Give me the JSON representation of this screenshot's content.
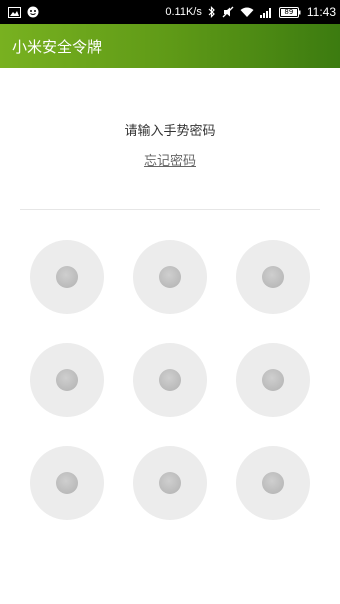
{
  "status_bar": {
    "network_speed": "0.11K/s",
    "battery_level": "89",
    "time": "11:43",
    "icons": [
      "image-icon",
      "notification-face-icon",
      "bluetooth-icon",
      "silent-icon",
      "wifi-icon",
      "signal-icon",
      "battery-icon"
    ]
  },
  "app_bar": {
    "title": "小米安全令牌",
    "gradient_colors": [
      "#78b120",
      "#3c7b10"
    ]
  },
  "lock": {
    "prompt": "请输入手势密码",
    "forgot_link": "忘记密码"
  },
  "pattern_grid": {
    "rows": 3,
    "cols": 3,
    "node_color": "#ececec",
    "dot_color": "#bdbdbd"
  }
}
